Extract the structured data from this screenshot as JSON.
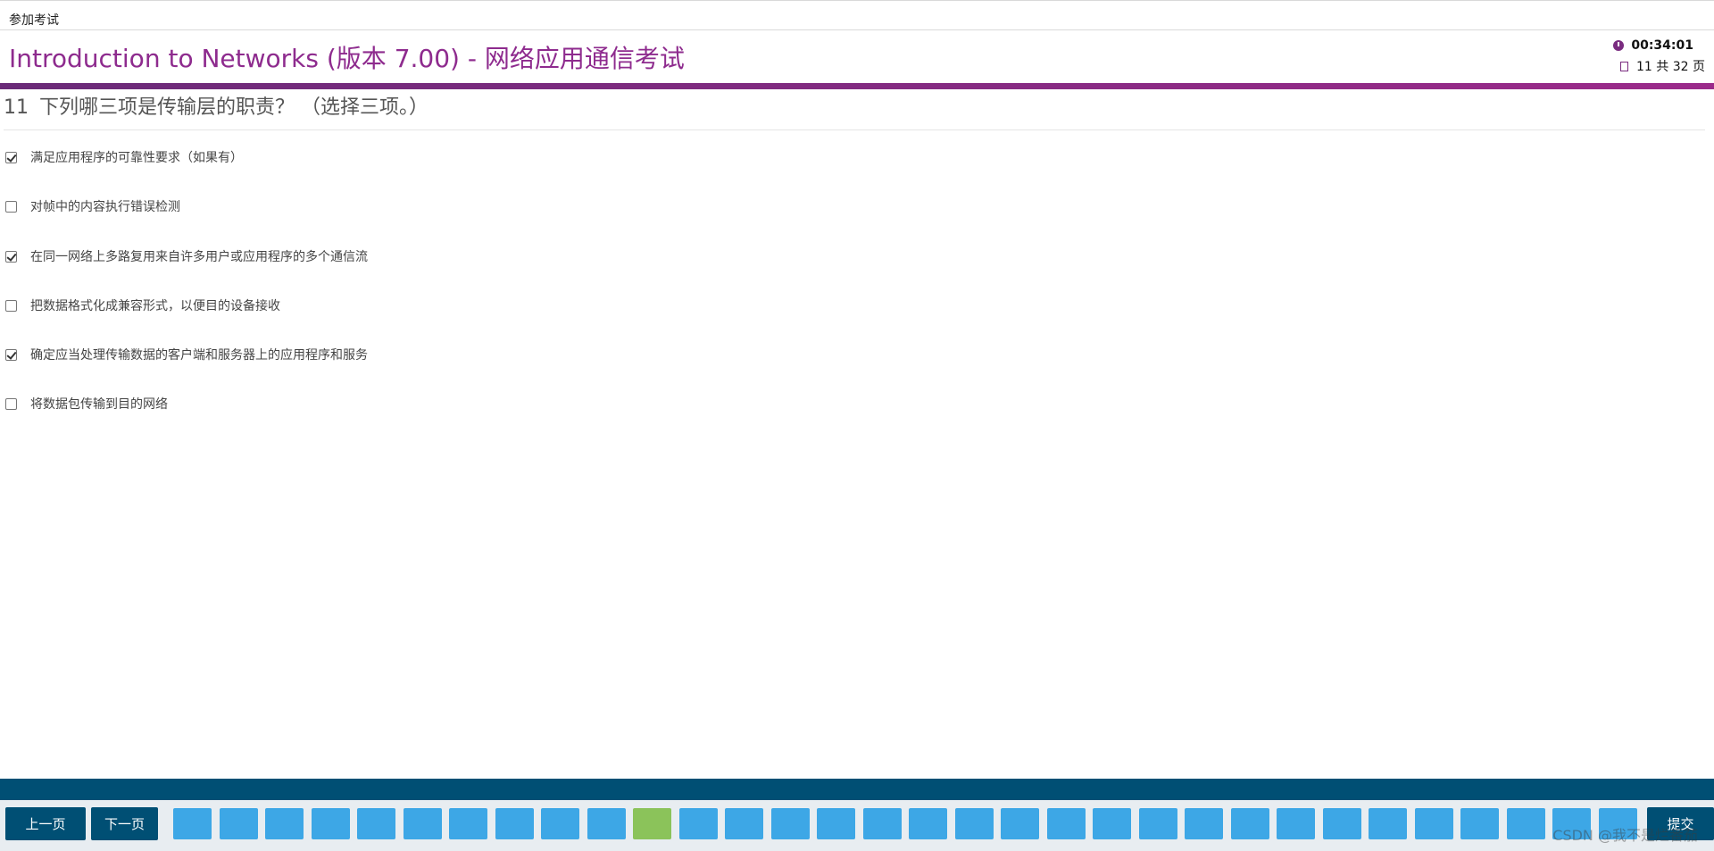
{
  "topbar": {
    "label": "参加考试"
  },
  "header": {
    "exam_title": "Introduction to Networks (版本 7.00) - 网络应用通信考试",
    "timer": "00:34:01",
    "page_info": "11 共 32 页"
  },
  "question": {
    "number": "11",
    "text": "下列哪三项是传输层的职责？ （选择三项。）"
  },
  "options": [
    {
      "label": "满足应用程序的可靠性要求（如果有）",
      "checked": true
    },
    {
      "label": "对帧中的内容执行错误检测",
      "checked": false
    },
    {
      "label": "在同一网络上多路复用来自许多用户或应用程序的多个通信流",
      "checked": true
    },
    {
      "label": "把数据格式化成兼容形式，以便目的设备接收",
      "checked": false
    },
    {
      "label": "确定应当处理传输数据的客户端和服务器上的应用程序和服务",
      "checked": true
    },
    {
      "label": "将数据包传输到目的网络",
      "checked": false
    }
  ],
  "footer": {
    "prev_label": "上一页",
    "next_label": "下一页",
    "submit_label": "提交",
    "total_pages": 32,
    "current_page": 11
  },
  "watermark": "CSDN @我不是烂番茄",
  "colors": {
    "title_purple": "#8e2b8e",
    "nav_dark_blue": "#004f74",
    "page_box_blue": "#3da7e6",
    "current_page_green": "#8bc35a"
  }
}
